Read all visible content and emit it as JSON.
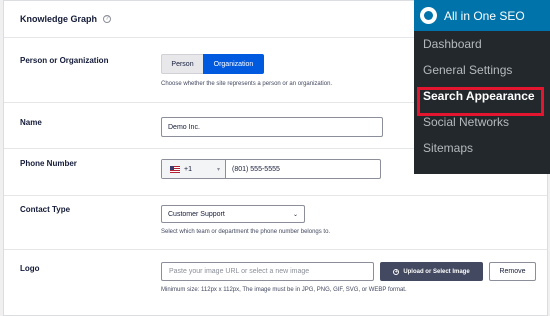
{
  "card": {
    "title": "Knowledge Graph",
    "help_icon": "question-circle-icon"
  },
  "person_org": {
    "label": "Person or Organization",
    "options": [
      "Person",
      "Organization"
    ],
    "selected": "Organization",
    "help": "Choose whether the site represents a person or an organization."
  },
  "name": {
    "label": "Name",
    "value": "Demo Inc."
  },
  "phone": {
    "label": "Phone Number",
    "country_flag": "us-flag-icon",
    "country_code": "+1",
    "value": "(801) 555-5555"
  },
  "contact_type": {
    "label": "Contact Type",
    "value": "Customer Support",
    "help": "Select which team or department the phone number belongs to."
  },
  "logo": {
    "label": "Logo",
    "placeholder": "Paste your image URL or select a new image",
    "upload_label": "Upload or Select Image",
    "remove_label": "Remove",
    "help": "Minimum size: 112px x 112px, The image must be in JPG, PNG, GIF, SVG, or WEBP format."
  },
  "wp_menu": {
    "title": "All in One SEO",
    "items": [
      "Dashboard",
      "General Settings",
      "Search Appearance",
      "Social Networks",
      "Sitemaps"
    ],
    "active": "Search Appearance",
    "highlight_color": "#e4152e"
  },
  "colors": {
    "accent": "#005ae0",
    "menu_bg": "#23282d",
    "menu_head": "#0073aa"
  }
}
